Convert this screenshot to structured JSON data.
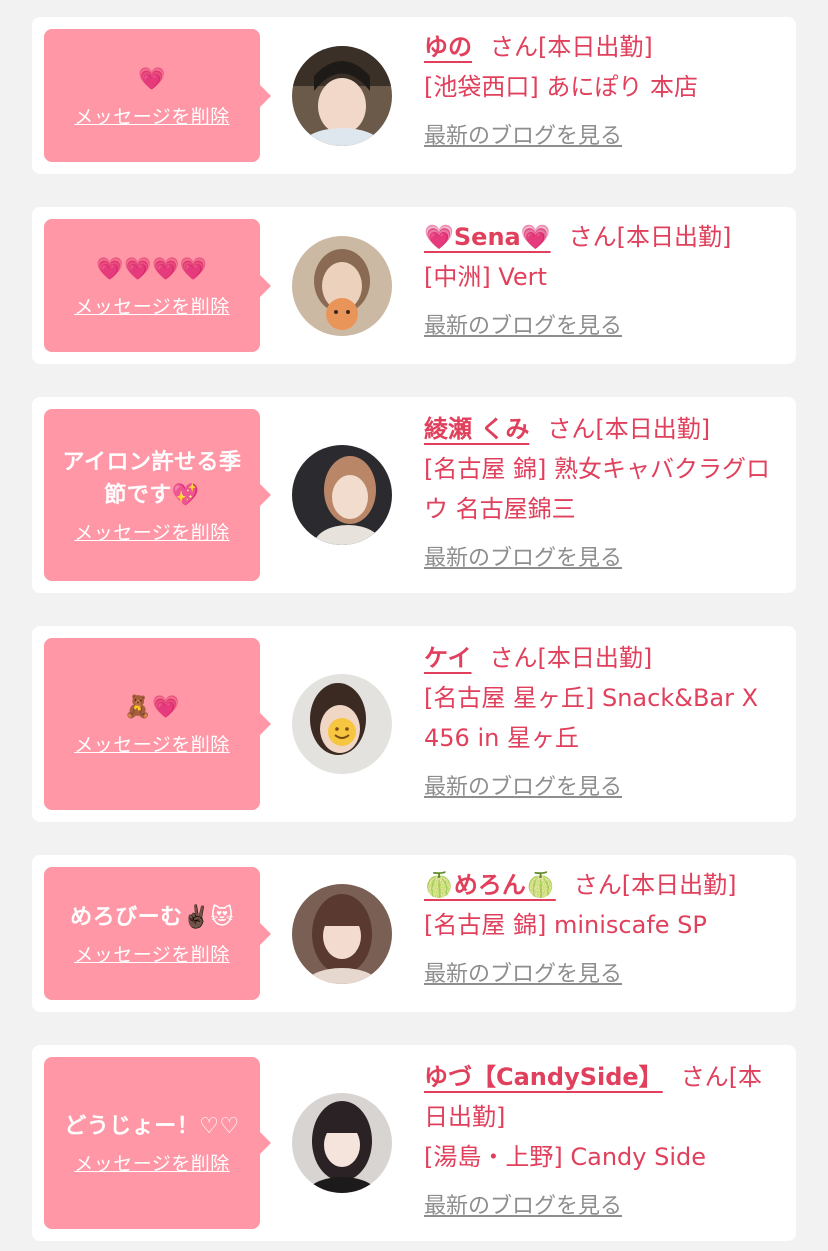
{
  "common": {
    "delete_label": "メッセージを削除",
    "san": "さん",
    "blog_label": "最新のブログを見る"
  },
  "colors": {
    "page_bg": "#f2f2f2",
    "bubble": "#ff97a6",
    "accent": "#e0405c",
    "muted": "#8e8e8e"
  },
  "entries": [
    {
      "message": "💗",
      "name": "ゆの",
      "status": "[本日出勤]",
      "shop": "[池袋西口] あにぽり 本店"
    },
    {
      "message": "💗💗💗💗",
      "name": "💗Sena💗",
      "status": "[本日出勤]",
      "shop": "[中洲] Vert"
    },
    {
      "message": "アイロン許せる季節です💖",
      "name": "綾瀬 くみ",
      "status": "[本日出勤]",
      "shop": "[名古屋 錦] 熟女キャバクラグロウ 名古屋錦三"
    },
    {
      "message": "🧸💗",
      "name": "ケイ",
      "status": "[本日出勤]",
      "shop": "[名古屋 星ヶ丘] Snack&Bar X 456 in 星ヶ丘"
    },
    {
      "message": "めろびーむ✌🏿😻",
      "name": "🍈めろん🍈",
      "status": "[本日出勤]",
      "shop": "[名古屋 錦] miniscafe SP"
    },
    {
      "message": "どうじょー！♡♡",
      "name": "ゆづ【CandySide】",
      "status": "[本日出勤]",
      "shop": "[湯島・上野] Candy Side"
    }
  ]
}
